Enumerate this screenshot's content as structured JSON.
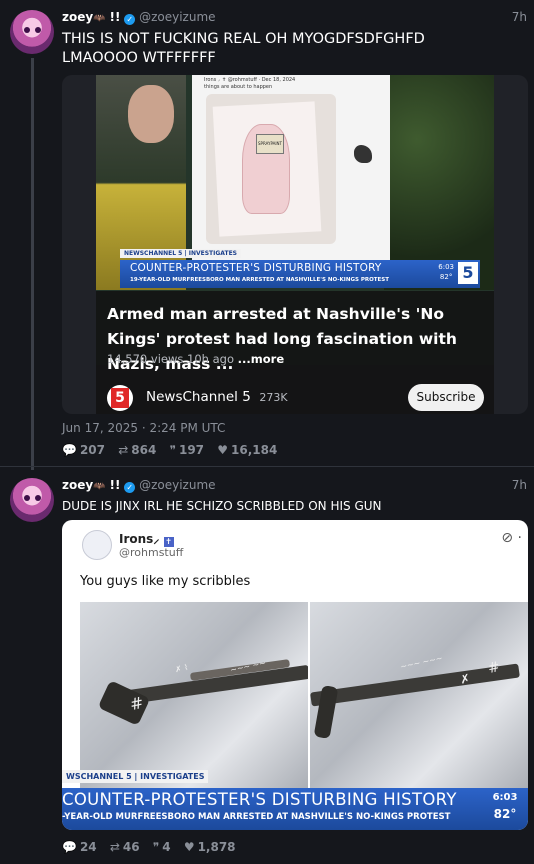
{
  "posts": [
    {
      "display_name": "zoey",
      "name_emoji": "🦇",
      "name_suffix": "!!",
      "handle": "@zoeyizume",
      "time": "7h",
      "text": "THIS IS NOT FUCKING REAL OH MYOGDFSDFGHFD LMAOOOO WTFFFFFF",
      "card": {
        "screen_title": "Irons ⸝ ✝ @rohmstuff · Dec 18, 2024",
        "screen_subtitle": "things are about to happen",
        "sign_text": "SPRAYPAINT",
        "news_tag": "NEWSCHANNEL 5 | INVESTIGATES",
        "news_headline": "COUNTER-PROTESTER'S DISTURBING HISTORY",
        "news_subline": "19-YEAR-OLD MURFREESBORO MAN ARRESTED AT NASHVILLE'S NO-KINGS PROTEST",
        "news_time": "6:03",
        "news_temp": "82°",
        "news_logo": "5",
        "video_title": "Armed man arrested at Nashville's 'No Kings' protest had long fascination with Nazis, mass ...",
        "views": "14,570 views",
        "ago": "10h ago",
        "more": "...more",
        "channel_logo": "5",
        "channel_name": "NewsChannel 5",
        "subscribers": "273K",
        "subscribe_label": "Subscribe"
      },
      "date": "Jun 17, 2025 · 2:24 PM UTC",
      "stats": {
        "replies": "207",
        "reposts": "864",
        "quotes": "197",
        "likes": "16,184"
      }
    },
    {
      "display_name": "zoey",
      "name_emoji": "🦇",
      "name_suffix": "!!",
      "handle": "@zoeyizume",
      "time": "7h",
      "text": "DUDE IS JINX IRL HE SCHIZO SCRIBBLED ON HIS GUN",
      "card": {
        "author_name": "Irons⸝",
        "author_handle": "@rohmstuff",
        "tweet_text": "You guys like my scribbles",
        "news_tag": "WSCHANNEL 5 | INVESTIGATES",
        "news_headline": "COUNTER-PROTESTER'S DISTURBING HISTORY",
        "news_subline": "-YEAR-OLD MURFREESBORO MAN ARRESTED AT NASHVILLE'S NO-KINGS PROTEST",
        "news_time": "6:03",
        "news_temp": "82°"
      },
      "stats": {
        "replies": "24",
        "reposts": "46",
        "quotes": "4",
        "likes": "1,878"
      }
    }
  ],
  "icons": {
    "reply": "💬",
    "repost": "⇄",
    "quote": "❞",
    "like": "♥",
    "verified": "✓",
    "cross": "✝",
    "more": "⋯"
  }
}
